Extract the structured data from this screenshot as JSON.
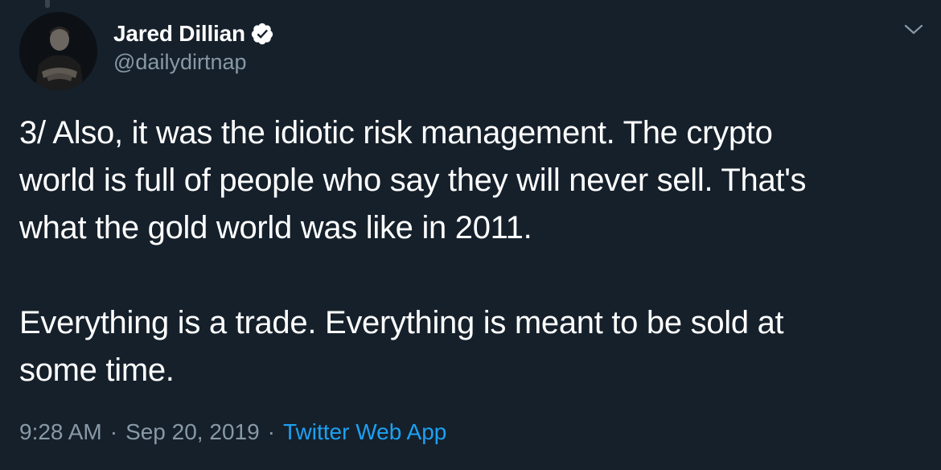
{
  "user": {
    "display_name": "Jared Dillian",
    "handle": "@dailydirtnap",
    "verified": true,
    "avatar_icon": "profile-photo"
  },
  "tweet": {
    "text": "3/ Also, it was the idiotic risk management. The crypto\nworld is full of people who say they will never sell. That's\nwhat the gold world was like in 2011.\n\nEverything is a trade. Everything is meant to be sold at\nsome time."
  },
  "meta": {
    "time": "9:28 AM",
    "separator": "·",
    "date": "Sep 20, 2019",
    "source": "Twitter Web App"
  },
  "colors": {
    "background": "#15202b",
    "text": "#ffffff",
    "secondary": "#8899a6",
    "link": "#1da1f2"
  },
  "icons": {
    "verified": "verified-badge-icon",
    "menu": "chevron-down-icon"
  }
}
